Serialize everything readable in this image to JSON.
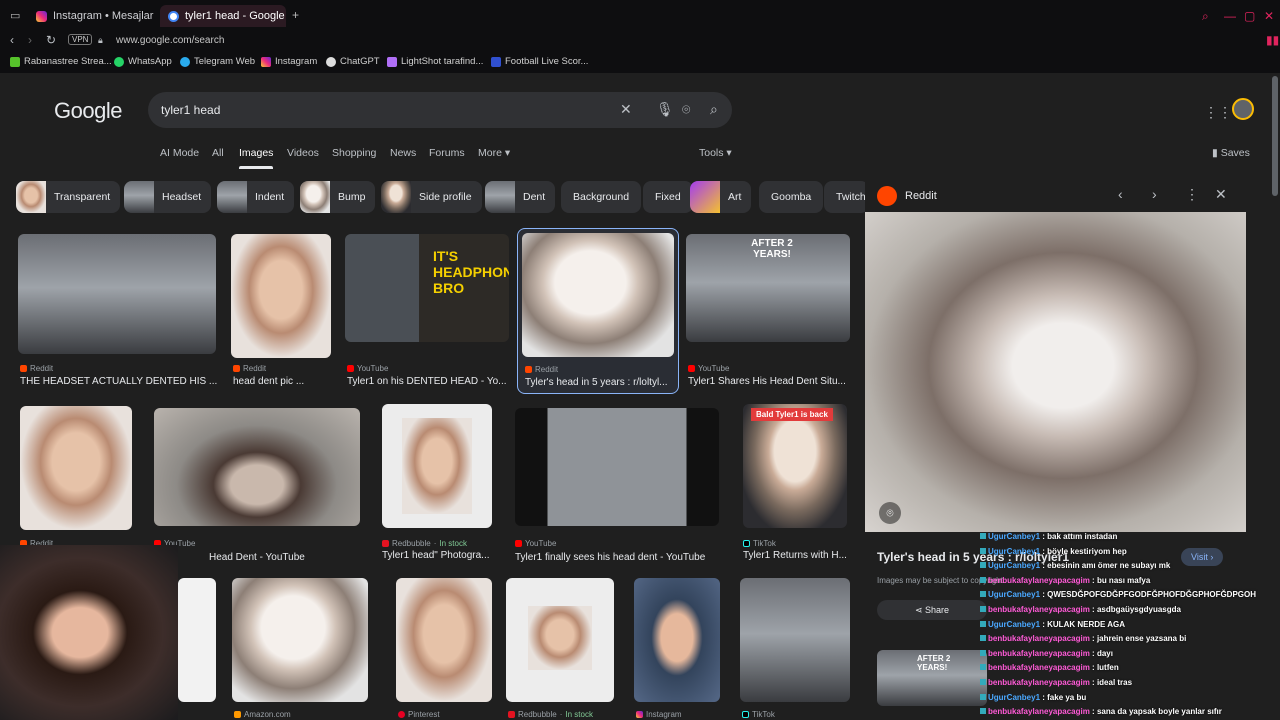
{
  "tabs": [
    {
      "title": "Instagram • Mesajlar"
    },
    {
      "title": "tyler1 head - Google Search"
    }
  ],
  "address": {
    "url": "www.google.com/search",
    "vpn": "VPN"
  },
  "bookmarks": [
    "Rabanastree Strea...",
    "WhatsApp",
    "Telegram Web",
    "Instagram",
    "ChatGPT",
    "LightShot tarafind...",
    "Football Live Scor..."
  ],
  "google": {
    "logo": "Google",
    "query": "tyler1 head",
    "nav": [
      "AI Mode",
      "All",
      "Images",
      "Videos",
      "Shopping",
      "News",
      "Forums",
      "More ▾"
    ],
    "tools": "Tools ▾",
    "saves": "Saves"
  },
  "chips": [
    "Transparent",
    "Headset",
    "Indent",
    "Bump",
    "Side profile",
    "Dent",
    "Background",
    "Fixed",
    "Art",
    "Goomba",
    "Twitch"
  ],
  "results": [
    {
      "source": "Reddit",
      "title": "THE HEADSET ACTUALLY DENTED HIS ..."
    },
    {
      "source": "Reddit",
      "title": "head dent pic ..."
    },
    {
      "source": "YouTube",
      "title": "Tyler1 on his DENTED HEAD - Yo...",
      "overlay": "IT'S HEADPHONES BRO"
    },
    {
      "source": "Reddit",
      "title": "Tyler's head in 5 years : r/loltyl..."
    },
    {
      "source": "YouTube",
      "title": "Tyler1 Shares His Head Dent Situ...",
      "overlay": "AFTER 2 YEARS!"
    },
    {
      "source": "Reddit",
      "title": ""
    },
    {
      "source": "YouTube",
      "title": "Head Dent - YouTube"
    },
    {
      "source": "Redbubble",
      "stock": "In stock",
      "title": "Tyler1 head\" Photogra..."
    },
    {
      "source": "YouTube",
      "title": "Tyler1 finally sees his head dent - YouTube"
    },
    {
      "source": "TikTok",
      "title": "Tyler1 Returns with H...",
      "overlay": "Bald Tyler1 is back"
    },
    {
      "source": "Amazon.com",
      "title": ""
    },
    {
      "source": "Pinterest",
      "title": ""
    },
    {
      "source": "Redbubble",
      "stock": "In stock",
      "title": ""
    },
    {
      "source": "Instagram",
      "title": ""
    },
    {
      "source": "TikTok",
      "title": ""
    }
  ],
  "panel": {
    "source": "Reddit",
    "title": "Tyler's head in 5 years : r/loltyler1",
    "note": "Images may be subject to copyright.",
    "visit": "Visit ›",
    "share": "Share",
    "related_overlay": "AFTER 2 YEARS!"
  },
  "chat": [
    {
      "user": "UgurCanbey1",
      "text": ": bak attım instadan",
      "c": 1
    },
    {
      "user": "UgurCanbey1",
      "text": ": böyle kestiriyom hep",
      "c": 1
    },
    {
      "user": "UgurCanbey1",
      "text": ": ebesinin amı ömer ne subayı mk",
      "c": 1
    },
    {
      "user": "benbukafaylaneyapacagim",
      "text": ": bu nası mafya",
      "c": 2
    },
    {
      "user": "UgurCanbey1",
      "text": ": QWESDĞPOFGDĞPFGODFĞPHOFDĞGPHOFĞDPGOH",
      "c": 1
    },
    {
      "user": "benbukafaylaneyapacagim",
      "text": ": asdbgaüysgdyuasgda",
      "c": 2
    },
    {
      "user": "UgurCanbey1",
      "text": ": KULAK NERDE AGA",
      "c": 1
    },
    {
      "user": "benbukafaylaneyapacagim",
      "text": ": jahrein ense yazsana bi",
      "c": 2
    },
    {
      "user": "benbukafaylaneyapacagim",
      "text": ": dayı",
      "c": 2
    },
    {
      "user": "benbukafaylaneyapacagim",
      "text": ": lutfen",
      "c": 2
    },
    {
      "user": "benbukafaylaneyapacagim",
      "text": ": ideal tras",
      "c": 2
    },
    {
      "user": "UgurCanbey1",
      "text": ": fake ya bu",
      "c": 1
    },
    {
      "user": "benbukafaylaneyapacagim",
      "text": ": sana da yapsak boyle yanlar sıfır",
      "c": 2
    }
  ],
  "colors": {
    "accent": "#e8eaed",
    "reddit": "#ff4500",
    "youtube": "#ff0000",
    "instock": "#81c995"
  }
}
